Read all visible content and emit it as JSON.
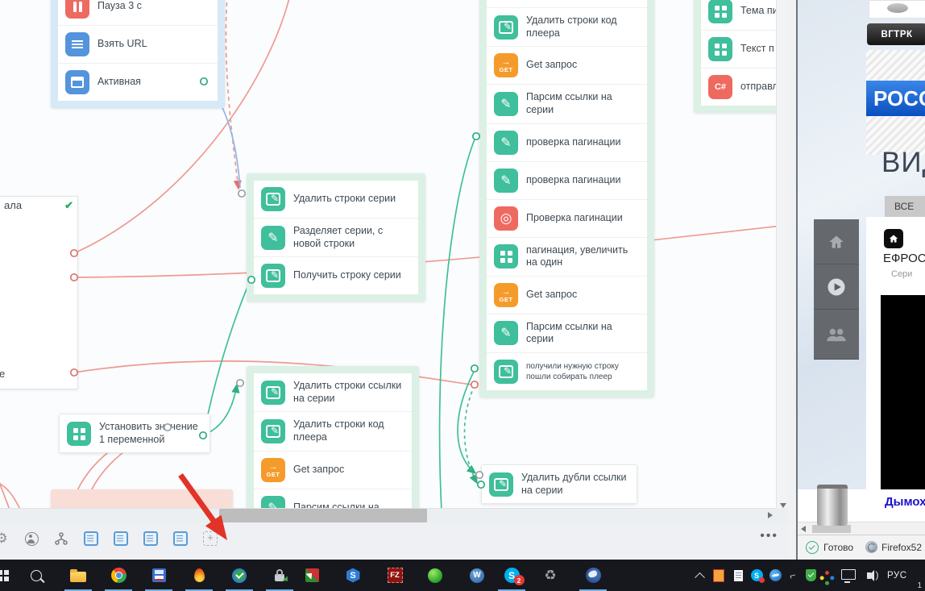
{
  "flow": {
    "groups": {
      "browser_actions": {
        "blocks": [
          {
            "icon": "pause",
            "label": "Пауза 3 с"
          },
          {
            "icon": "lines",
            "label": "Взять URL"
          },
          {
            "icon": "window",
            "label": "Активная"
          }
        ]
      },
      "series": {
        "blocks": [
          {
            "icon": "note",
            "label": "Удалить строки серии"
          },
          {
            "icon": "pencil",
            "label": "Разделяет серии, с новой строки"
          },
          {
            "icon": "note",
            "label": "Получить строку серии"
          }
        ]
      },
      "links": {
        "blocks": [
          {
            "icon": "note",
            "label": "Удалить строки ссылки на серии"
          },
          {
            "icon": "note",
            "label": "Удалить строки код плеера"
          },
          {
            "icon": "get",
            "label": "Get запрос"
          },
          {
            "icon": "pencil",
            "label": "Парсим ссылки на"
          }
        ]
      },
      "center": {
        "blocks": [
          {
            "icon": "note",
            "label": "Удалить строки код плеера"
          },
          {
            "icon": "get",
            "label": "Get запрос"
          },
          {
            "icon": "pencil",
            "label": "Парсим ссылки на серии"
          },
          {
            "icon": "pencil",
            "label": "проверка пагинации"
          },
          {
            "icon": "pencil",
            "label": "проверка пагинации"
          },
          {
            "icon": "eye",
            "label": "Проверка пагинации"
          },
          {
            "icon": "grid",
            "label": "пагинация, увеличить на один"
          },
          {
            "icon": "get",
            "label": "Get запрос"
          },
          {
            "icon": "pencil",
            "label": "Парсим ссылки на серии"
          },
          {
            "icon": "note",
            "label": "получили нужную строку пошли собирать плеер",
            "small": "true"
          }
        ]
      },
      "mail": {
        "blocks": [
          {
            "icon": "grid",
            "label": "Тема пи"
          },
          {
            "icon": "grid",
            "label": "Текст п"
          },
          {
            "icon": "csharp",
            "label": "отправл"
          }
        ]
      }
    },
    "standalone": {
      "set_variable": {
        "label": "Установить значение 1 переменной"
      },
      "dedupe": {
        "label": "Удалить дубли ссылки на серии"
      }
    },
    "left_panel": {
      "text_top": "ала",
      "text_bottom": "е",
      "check": "✔"
    },
    "toolbar": {
      "ellipsis": "•••"
    }
  },
  "browser": {
    "button_vgtrk": "ВГТРК",
    "banner": "РОСС",
    "heading": "ВИД",
    "tab_all": "ВСЕ",
    "show_title": "ЕФРОС",
    "show_subtitle": "Сери",
    "product_link": "Дымох",
    "status_ready": "Готово",
    "status_browser": "Firefox52"
  },
  "taskbar": {
    "language": "РУС",
    "clock": "1",
    "skype_badge": "2"
  },
  "colors": {
    "action_green": "#3fbf9b",
    "action_orange": "#f59b2b",
    "action_red": "#ee6a60",
    "action_blue": "#5494dc",
    "connector_red": "#ef9a92",
    "connector_green": "#3fbf9a",
    "connector_blue": "#8fb4e8",
    "annotation_arrow": "#e13327"
  }
}
